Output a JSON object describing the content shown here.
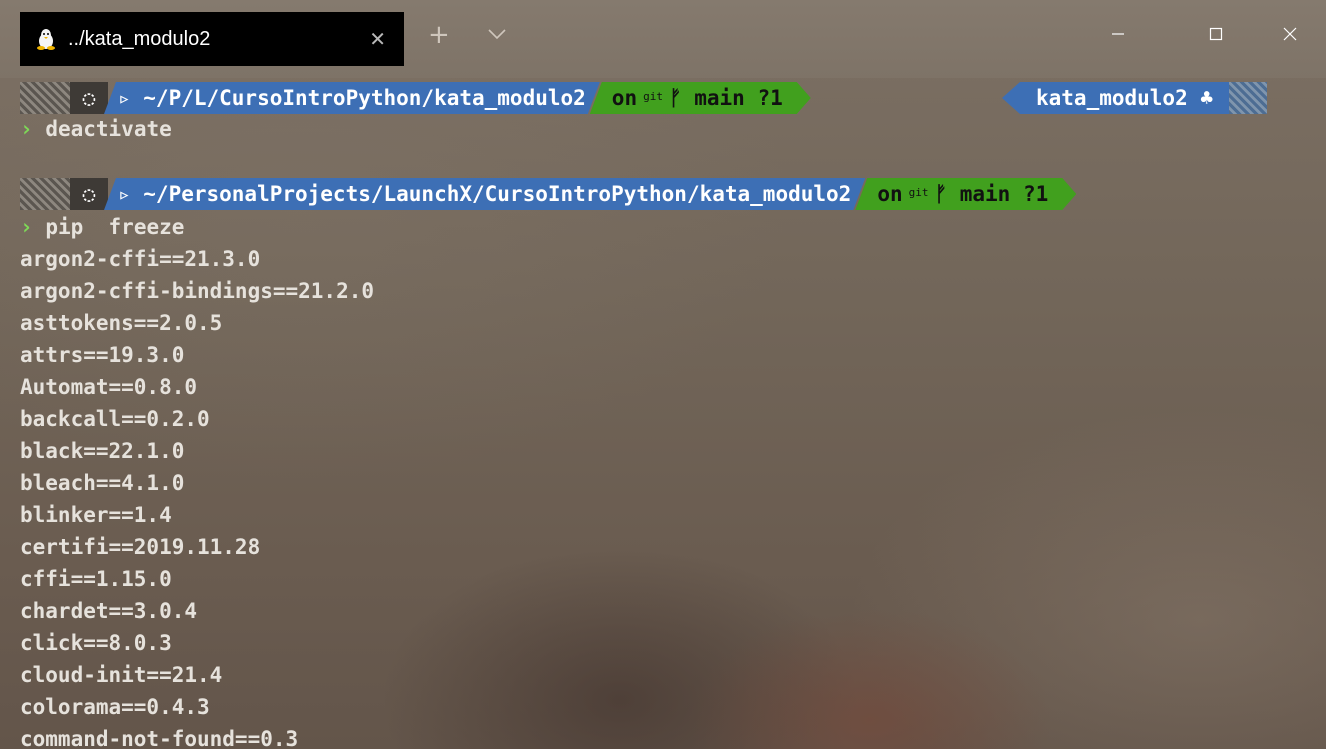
{
  "titlebar": {
    "tab_title": "../kata_modulo2",
    "tab_close": "✕",
    "new_tab": "+",
    "tab_icon": "linux-penguin-icon",
    "minimize_icon": "minimize-icon",
    "maximize_icon": "maximize-icon",
    "close_icon": "close-icon"
  },
  "prompts": [
    {
      "os_icon": "◌",
      "path": "▹ ~/P/L/CursoIntroPython/kata_modulo2",
      "git_on": "on",
      "git_label": "git",
      "git_branch_icon": "ᚠ",
      "git_branch": "main ?1",
      "venv": "kata_modulo2 ♣",
      "command": "deactivate"
    },
    {
      "os_icon": "◌",
      "path": "▹ ~/PersonalProjects/LaunchX/CursoIntroPython/kata_modulo2",
      "git_on": "on",
      "git_label": "git",
      "git_branch_icon": "ᚠ",
      "git_branch": "main ?1",
      "command": "pip  freeze"
    }
  ],
  "prompt_symbol": "›",
  "output": [
    "argon2-cffi==21.3.0",
    "argon2-cffi-bindings==21.2.0",
    "asttokens==2.0.5",
    "attrs==19.3.0",
    "Automat==0.8.0",
    "backcall==0.2.0",
    "black==22.1.0",
    "bleach==4.1.0",
    "blinker==1.4",
    "certifi==2019.11.28",
    "cffi==1.15.0",
    "chardet==3.0.4",
    "click==8.0.3",
    "cloud-init==21.4",
    "colorama==0.4.3",
    "command-not-found==0.3"
  ],
  "colors": {
    "path_segment": "#3d6fb5",
    "git_segment": "#41a01e",
    "prompt_chevron": "#7ed957",
    "text": "#e6e2dc"
  }
}
